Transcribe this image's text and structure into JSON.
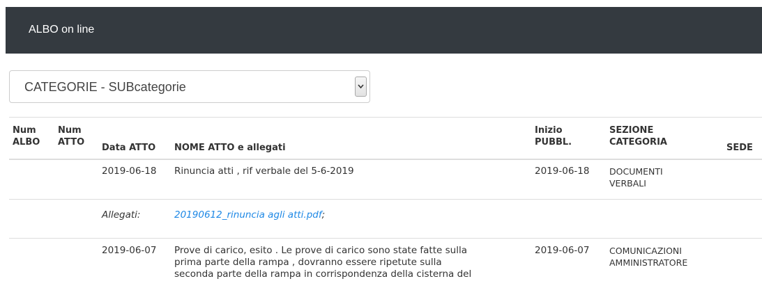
{
  "navbar": {
    "brand": "ALBO on line"
  },
  "filter": {
    "selected": "CATEGORIE - SUBcategorie"
  },
  "table": {
    "headers": {
      "num_albo_1": "Num",
      "num_albo_2": "ALBO",
      "num_atto_1": "Num",
      "num_atto_2": "ATTO",
      "data_atto": "Data ATTO",
      "nome_atto": "NOME ATTO e allegati",
      "inizio_1": "Inizio",
      "inizio_2": "PUBBL.",
      "sezione_1": "SEZIONE",
      "sezione_2": "CATEGORIA",
      "sede": "SEDE"
    },
    "rows": [
      {
        "data_atto": "2019-06-18",
        "nome_atto": "Rinuncia atti , rif verbale del 5-6-2019",
        "inizio_pubbl": "2019-06-18",
        "sezione": "DOCUMENTI",
        "categoria": "VERBALI"
      },
      {
        "data_atto": "2019-06-07",
        "nome_line_1": "Prove di carico, esito . Le prove di carico sono state fatte sulla",
        "nome_line_2": "prima parte della rampa , dovranno essere ripetute sulla",
        "nome_line_3": "seconda parte della rampa in corrispondenza della cisterna del",
        "inizio_pubbl": "2019-06-07",
        "sezione": "COMUNICAZIONI",
        "categoria": "AMMINISTRATORE"
      }
    ],
    "attachment": {
      "label": "Allegati:",
      "file": "20190612_rinuncia agli atti.pdf",
      "separator": ";"
    }
  },
  "colors": {
    "navbar_bg": "#343a40",
    "link": "#1e88e5"
  }
}
